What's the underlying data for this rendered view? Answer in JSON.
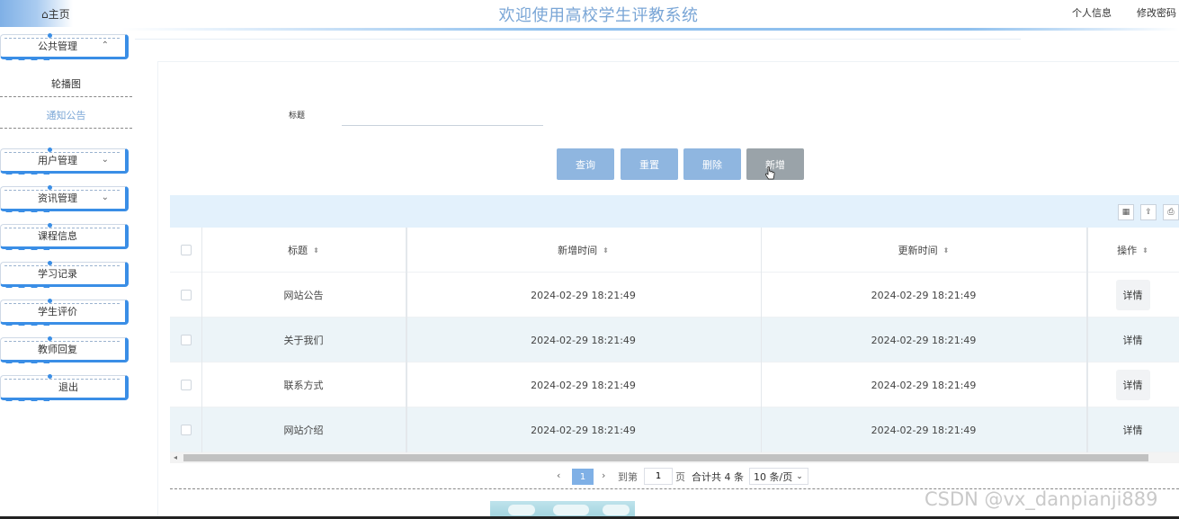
{
  "header": {
    "home_label": "主页",
    "title": "欢迎使用高校学生评教系统",
    "personal_info": "个人信息",
    "change_password": "修改密码"
  },
  "sidebar": {
    "groups": [
      {
        "label": "公共管理",
        "expanded": true
      },
      {
        "label": "用户管理"
      },
      {
        "label": "资讯管理"
      },
      {
        "label": "课程信息"
      },
      {
        "label": "学习记录"
      },
      {
        "label": "学生评价"
      },
      {
        "label": "教师回复"
      },
      {
        "label": "退出"
      }
    ],
    "subitems": [
      "轮播图",
      "通知公告"
    ],
    "active_subitem": "通知公告"
  },
  "search": {
    "label": "标题",
    "value": ""
  },
  "buttons": {
    "query": "查询",
    "reset": "重置",
    "delete": "删除",
    "add": "新增"
  },
  "table": {
    "columns": [
      "标题",
      "新增时间",
      "更新时间",
      "操作"
    ],
    "rows": [
      {
        "title": "网站公告",
        "created": "2024-02-29 18:21:49",
        "updated": "2024-02-29 18:21:49",
        "action": "详情"
      },
      {
        "title": "关于我们",
        "created": "2024-02-29 18:21:49",
        "updated": "2024-02-29 18:21:49",
        "action": "详情"
      },
      {
        "title": "联系方式",
        "created": "2024-02-29 18:21:49",
        "updated": "2024-02-29 18:21:49",
        "action": "详情"
      },
      {
        "title": "网站介绍",
        "created": "2024-02-29 18:21:49",
        "updated": "2024-02-29 18:21:49",
        "action": "详情"
      }
    ]
  },
  "pager": {
    "prev": "‹",
    "current": "1",
    "next": "›",
    "goto_label": "到第",
    "goto_value": "1",
    "page_unit": "页",
    "total": "合计共 4 条",
    "page_size": "10 条/页"
  },
  "watermark": "CSDN @vx_danpianji889",
  "colors": {
    "accent": "#3a8ee6",
    "button": "#8fb6e0",
    "title": "#7aa6d6",
    "toolbar": "#e3f1fc"
  }
}
